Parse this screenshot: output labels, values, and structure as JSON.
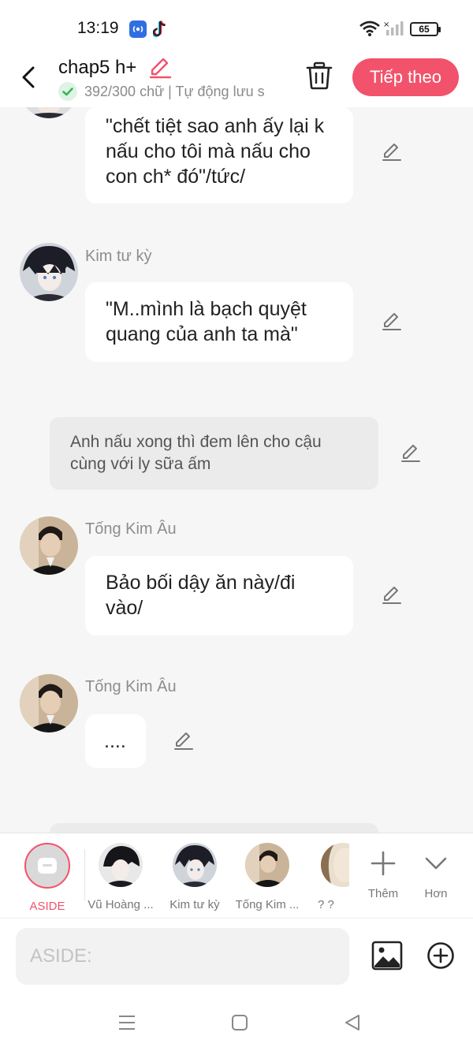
{
  "status": {
    "time": "13:19",
    "battery": "65"
  },
  "header": {
    "title": "chap5 h+",
    "saved_text": "392/300 chữ | Tự động lưu s",
    "next_label": "Tiếp theo"
  },
  "messages": [
    {
      "type": "bubble",
      "text": "\"chết tiệt sao anh ấy lại k nấu cho tôi mà nấu cho con ch* đó\"/tức/"
    },
    {
      "type": "bubble",
      "sender": "Kim tư kỳ",
      "text": "\"M..mình là bạch quyệt quang của anh ta mà\""
    },
    {
      "type": "narration",
      "text": "Anh nấu xong thì đem lên cho cậu cùng với ly sữa ấm"
    },
    {
      "type": "bubble",
      "sender": "Tống Kim Âu",
      "text": "Bảo bối dậy ăn này/đi vào/"
    },
    {
      "type": "bubble",
      "sender": "Tống Kim Âu",
      "text": "...."
    }
  ],
  "characters": [
    {
      "name": "ASIDE",
      "active": true
    },
    {
      "name": "Vũ Hoàng ..."
    },
    {
      "name": "Kim tư kỳ"
    },
    {
      "name": "Tống Kim ..."
    },
    {
      "name": "? ?"
    }
  ],
  "actions": {
    "add_label": "Thêm",
    "more_label": "Hơn"
  },
  "input": {
    "placeholder": "ASIDE:"
  },
  "colors": {
    "accent": "#f2526b",
    "check": "#38b55a"
  }
}
